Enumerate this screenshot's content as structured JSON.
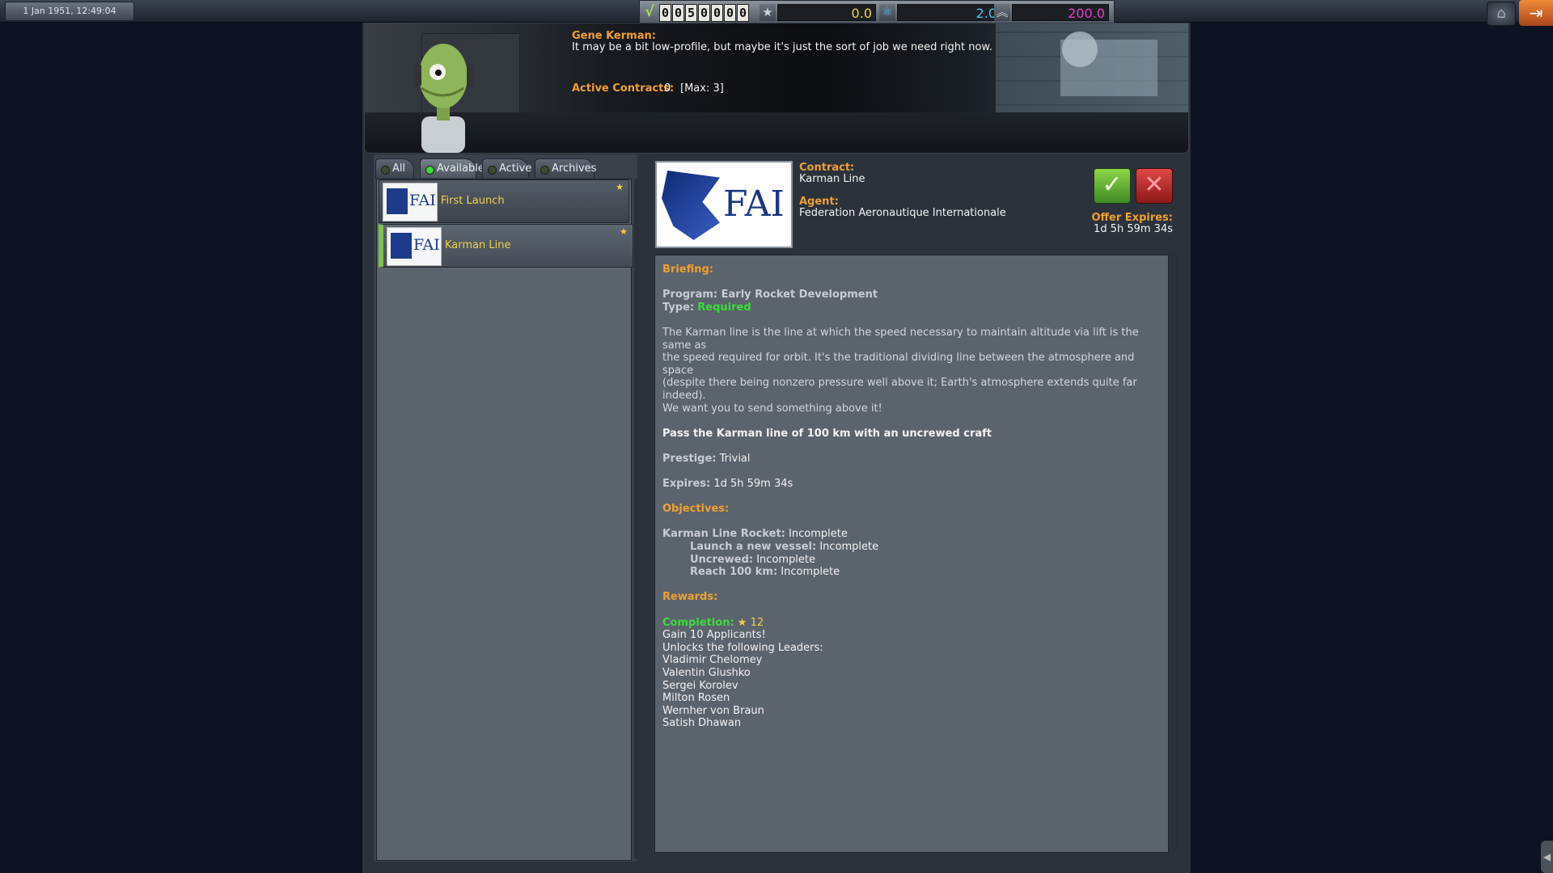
{
  "topbar": {
    "date": "1 Jan 1951, 12:49:04",
    "funds_digits": [
      "0",
      "0",
      "5",
      "0",
      "0",
      "0",
      "0"
    ],
    "reputation": "0.0",
    "science": "2.0",
    "confidence": "200.0",
    "colors": {
      "reputation": "#f2d04a",
      "science": "#4cc0f0",
      "confidence": "#e040c8"
    },
    "icons": {
      "funds": "funds-icon",
      "reputation": "star-icon",
      "science": "atom-icon",
      "confidence": "chevrons-icon",
      "button1": "app-launcher-icon",
      "button2": "exit-icon"
    }
  },
  "banner": {
    "speaker_name": "Gene Kerman:",
    "speaker_text": "It may be a bit low-profile, but maybe it's just the sort of job we need right now.",
    "active_label": "Active Contracts:",
    "active_value": "0",
    "active_max": "[Max: 3]"
  },
  "tabs": [
    {
      "label": "All",
      "selected": false
    },
    {
      "label": "Available",
      "selected": true
    },
    {
      "label": "Active",
      "selected": false
    },
    {
      "label": "Archives",
      "selected": false
    }
  ],
  "contracts": [
    {
      "logo": "FAI",
      "name": "First Launch",
      "selected": false
    },
    {
      "logo": "FAI",
      "name": "Karman Line",
      "selected": true
    }
  ],
  "detail": {
    "logo": "FAI",
    "contract_label": "Contract:",
    "contract_name": "Karman Line",
    "agent_label": "Agent:",
    "agent_name": "Federation Aeronautique Internationale",
    "offer_expires_label": "Offer Expires:",
    "offer_expires_value": "1d 5h 59m 34s",
    "briefing_header": "Briefing:",
    "program": "Program: Early Rocket Development",
    "type_label": "Type:",
    "type_value": "Required",
    "description_lines": [
      "The Karman line is the line at which the speed necessary to maintain altitude via lift is the same as",
      "the speed required for orbit. It's the traditional dividing line between the atmosphere and space",
      "(despite there being nonzero pressure well above it; Earth's atmosphere extends quite far indeed).",
      "We want you to send something above it!"
    ],
    "goal": "Pass the Karman line of 100 km with an uncrewed craft",
    "prestige_label": "Prestige:",
    "prestige_value": "Trivial",
    "expires_label": "Expires:",
    "expires_value": "1d 5h 59m 34s",
    "objectives_header": "Objectives:",
    "objectives": [
      {
        "label": "Karman Line Rocket:",
        "value": "Incomplete",
        "indent": false
      },
      {
        "label": "Launch a new vessel:",
        "value": "Incomplete",
        "indent": true
      },
      {
        "label": "Uncrewed:",
        "value": "Incomplete",
        "indent": true
      },
      {
        "label": "Reach 100 km:",
        "value": "Incomplete",
        "indent": true
      }
    ],
    "rewards_header": "Rewards:",
    "completion_label": "Completion:",
    "completion_value": "12",
    "reward_lines": [
      "Gain 10 Applicants!",
      "Unlocks the following Leaders:",
      "Vladimir Chelomey",
      "Valentin Glushko",
      "Sergei Korolev",
      "Milton Rosen",
      "Wernher von Braun",
      "Satish Dhawan"
    ]
  }
}
